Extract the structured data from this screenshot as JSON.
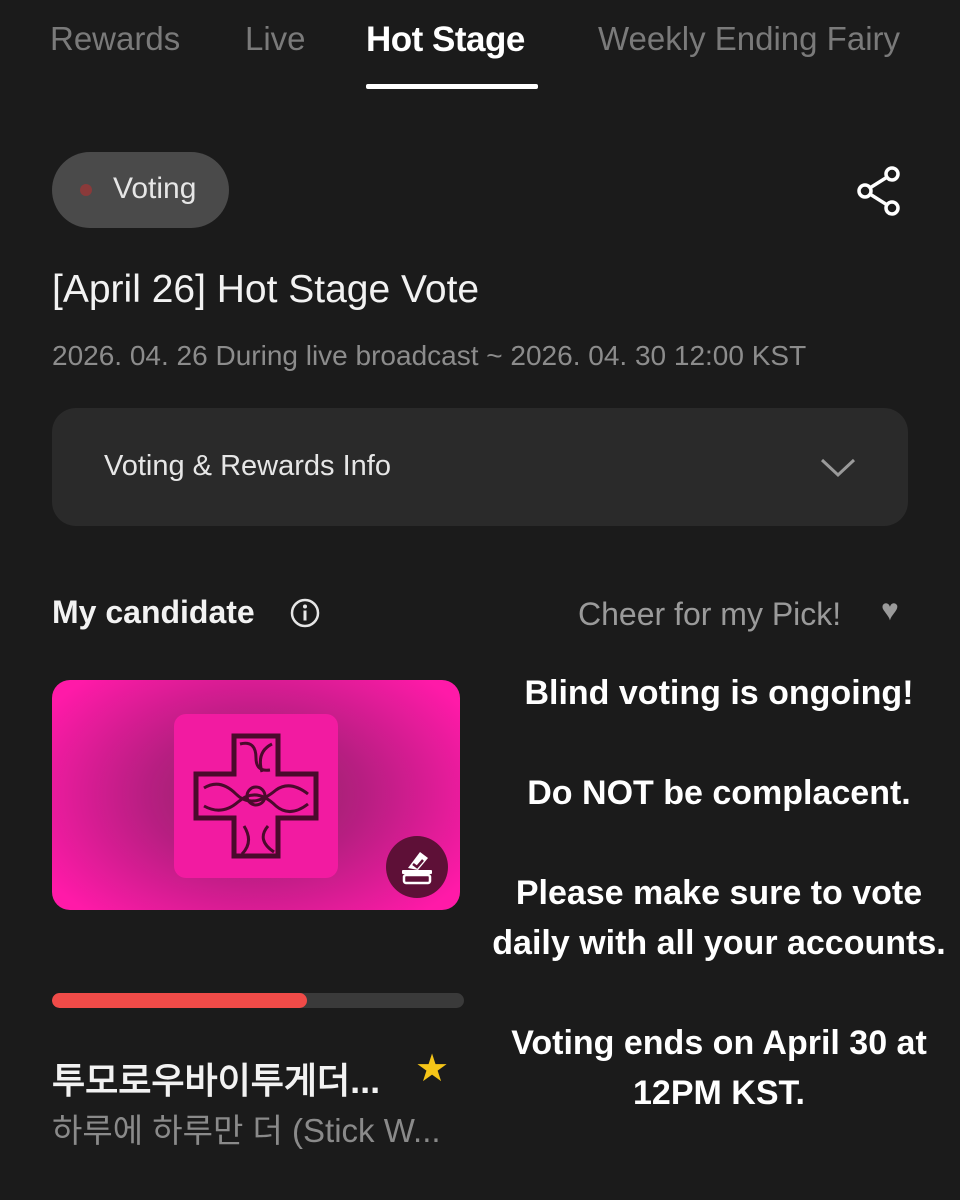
{
  "tabs": [
    {
      "label": "Rewards"
    },
    {
      "label": "Live"
    },
    {
      "label": "Hot Stage"
    },
    {
      "label": "Weekly Ending Fairy"
    }
  ],
  "active_tab": "Hot Stage",
  "status": {
    "label": "Voting",
    "dot_color": "#8a3a3a"
  },
  "share": {
    "icon": "share-icon"
  },
  "vote": {
    "title": "[April 26] Hot Stage Vote",
    "period": "2026. 04. 26 During live broadcast ~ 2026. 04. 30 12:00 KST"
  },
  "info_box": {
    "label": "Voting & Rewards Info",
    "icon": "chevron-down-icon"
  },
  "my_candidate": {
    "title": "My candidate",
    "cheer": "Cheer for my Pick!",
    "cheer_icon": "heart-icon"
  },
  "candidate": {
    "name": "투모로우바이투게더...",
    "song": "하루에 하루만 더 (Stick W...",
    "progress": 0.62,
    "accent": "#f04b48",
    "card_color": "#ff1aa8",
    "badge_icon": "vote-box-icon",
    "favorite_icon": "star-icon"
  },
  "notice": [
    "Blind voting is ongoing!",
    "Do NOT be complacent.",
    "Please make sure to vote daily with all your accounts.",
    "Voting ends on April 30 at 12PM KST."
  ]
}
